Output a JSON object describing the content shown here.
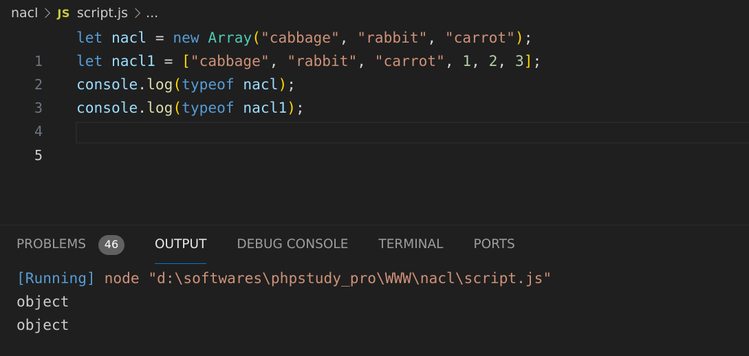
{
  "breadcrumb": {
    "folder": "nacl",
    "file_icon": "JS",
    "file": "script.js",
    "ellipsis": "..."
  },
  "editor": {
    "active_line": 5,
    "lines": [
      {
        "number": "1",
        "text": "let nacl = new Array(\"cabbage\", \"rabbit\", \"carrot\");"
      },
      {
        "number": "2",
        "text": "let nacl1 = [\"cabbage\", \"rabbit\", \"carrot\", 1, 2, 3];"
      },
      {
        "number": "3",
        "text": "console.log(typeof nacl);"
      },
      {
        "number": "4",
        "text": "console.log(typeof nacl1);"
      },
      {
        "number": "5",
        "text": ""
      }
    ],
    "tokens": {
      "l1": [
        "let",
        "nacl",
        "=",
        "new",
        "Array",
        "(",
        "\"cabbage\"",
        ", ",
        "\"rabbit\"",
        ", ",
        "\"carrot\"",
        ")",
        ";"
      ],
      "l2": [
        "let",
        "nacl1",
        "=",
        "[",
        "\"cabbage\"",
        ", ",
        "\"rabbit\"",
        ", ",
        "\"carrot\"",
        ", ",
        "1",
        ", ",
        "2",
        ", ",
        "3",
        "]",
        ";"
      ],
      "l3": [
        "console",
        ".",
        "log",
        "(",
        "typeof",
        "nacl",
        ")",
        ";"
      ],
      "l4": [
        "console",
        ".",
        "log",
        "(",
        "typeof",
        "nacl1",
        ")",
        ";"
      ]
    }
  },
  "panel": {
    "tabs": [
      {
        "label": "PROBLEMS",
        "badge": "46",
        "active": false
      },
      {
        "label": "OUTPUT",
        "active": true
      },
      {
        "label": "DEBUG CONSOLE",
        "active": false
      },
      {
        "label": "TERMINAL",
        "active": false
      },
      {
        "label": "PORTS",
        "active": false
      }
    ],
    "output": {
      "running_tag": "[Running]",
      "command": " node \"d:\\softwares\\phpstudy_pro\\WWW\\nacl\\script.js\"",
      "lines": [
        "object",
        "object"
      ]
    }
  },
  "colors": {
    "background": "#1f1f1f",
    "keyword": "#569cd6",
    "variable": "#9cdcfe",
    "class": "#4ec9b0",
    "string": "#ce9178",
    "number": "#b5cea8",
    "function": "#dcdcaa",
    "bracket_gold": "#ffd700",
    "bracket_orchid": "#da70d6",
    "active_tab_underline": "#0078d4"
  }
}
